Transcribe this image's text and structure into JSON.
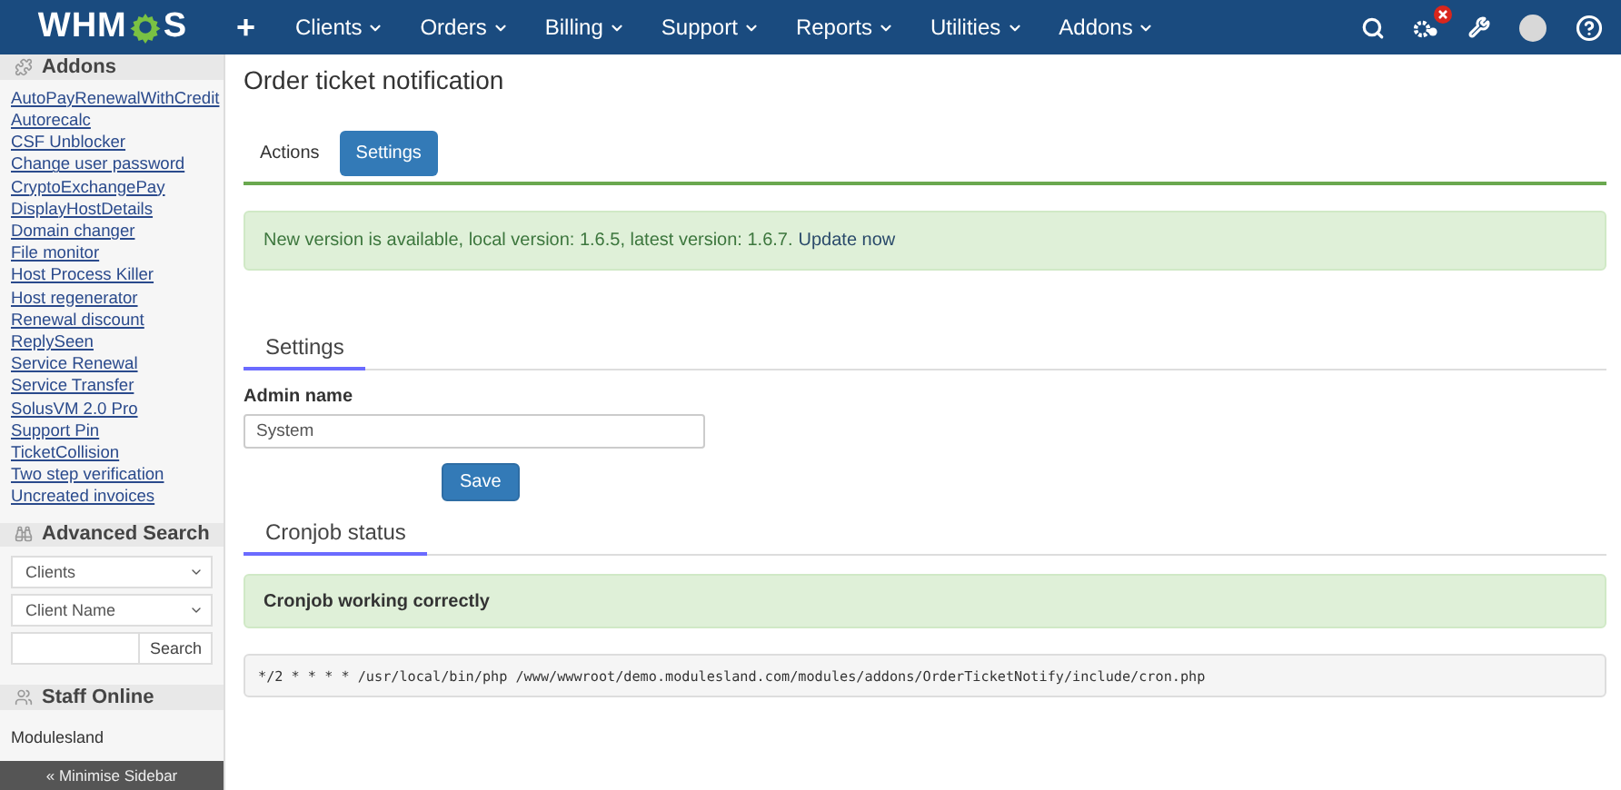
{
  "navbar": {
    "logo": {
      "before": "WHM",
      "after": "S"
    },
    "add": "+",
    "menus": [
      {
        "label": "Clients"
      },
      {
        "label": "Orders"
      },
      {
        "label": "Billing"
      },
      {
        "label": "Support"
      },
      {
        "label": "Reports"
      },
      {
        "label": "Utilities"
      },
      {
        "label": "Addons"
      }
    ],
    "badge": true
  },
  "sidebar": {
    "addons": {
      "title": "Addons",
      "items": [
        "AutoPayRenewalWithCredit",
        "Autorecalc",
        "CSF Unblocker",
        "Change user password",
        "CryptoExchangePay",
        "DisplayHostDetails",
        "Domain changer",
        "File monitor",
        "Host Process Killer",
        "Host regenerator",
        "Renewal discount",
        "ReplySeen",
        "Service Renewal",
        "Service Transfer",
        "SolusVM 2.0 Pro",
        "Support Pin",
        "TicketCollision",
        "Two step verification",
        "Uncreated invoices"
      ]
    },
    "advanced_search": {
      "title": "Advanced Search",
      "type_select": "Clients",
      "field_select": "Client Name",
      "button": "Search"
    },
    "staff_online": {
      "title": "Staff Online",
      "staff": [
        "Modulesland"
      ]
    },
    "minimise": "« Minimise Sidebar"
  },
  "page": {
    "title": "Order ticket notification",
    "tabs": [
      {
        "label": "Actions",
        "selected": false
      },
      {
        "label": "Settings",
        "selected": true
      }
    ],
    "update_alert": {
      "text": "New version is available, local version: 1.6.5, latest version: 1.6.7.",
      "link": "Update now"
    },
    "settings": {
      "heading": "Settings",
      "label": "Admin name",
      "value": "System",
      "button": "Save"
    },
    "cronjob": {
      "heading": "Cronjob status",
      "status": "Cronjob working correctly",
      "command": "*/2 * * * * /usr/local/bin/php /www/wwwroot/demo.modulesland.com/modules/addons/OrderTicketNotify/include/cron.php"
    }
  }
}
